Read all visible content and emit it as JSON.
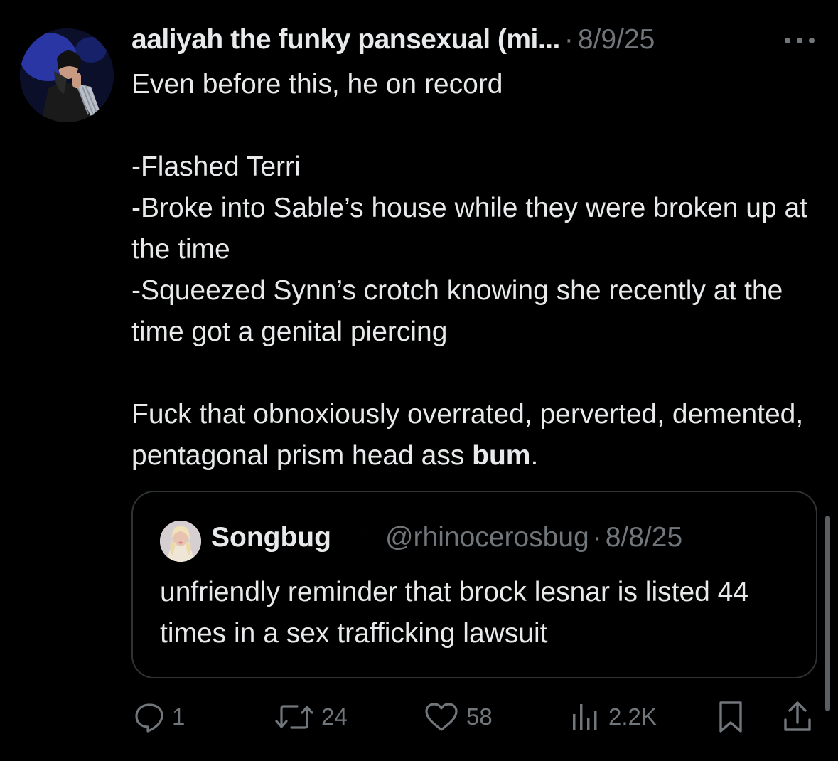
{
  "tweet": {
    "author_name": "aaliyah the funky pansexual (mi...",
    "separator": "·",
    "timestamp": "8/9/25",
    "more_icon": "more-horizontal-icon",
    "text": "Even before this, he on record\n\n-Flashed Terri\n-Broke into Sable’s house while they were broken up at the time\n-Squeezed Synn’s crotch knowing she recently at the time got a genital piercing\n\nFuck that obnoxiously overrated, perverted, demented, pentagonal prism head ass ",
    "text_bold_end": "bum",
    "text_tail": "."
  },
  "quote": {
    "name": "Songbug",
    "badge_icon": "crescent-moon-icon",
    "handle": "@rhinocerosbug",
    "separator": "·",
    "timestamp": "8/8/25",
    "text": "unfriendly reminder that brock lesnar is listed 44 times in a sex trafficking lawsuit"
  },
  "actions": {
    "reply_count": "1",
    "retweet_count": "24",
    "like_count": "58",
    "views_count": "2.2K"
  },
  "colors": {
    "background": "#000000",
    "primary_text": "#e7e9ea",
    "secondary_text": "#71767b",
    "border": "#2f3336",
    "moon": "#f5c518"
  }
}
